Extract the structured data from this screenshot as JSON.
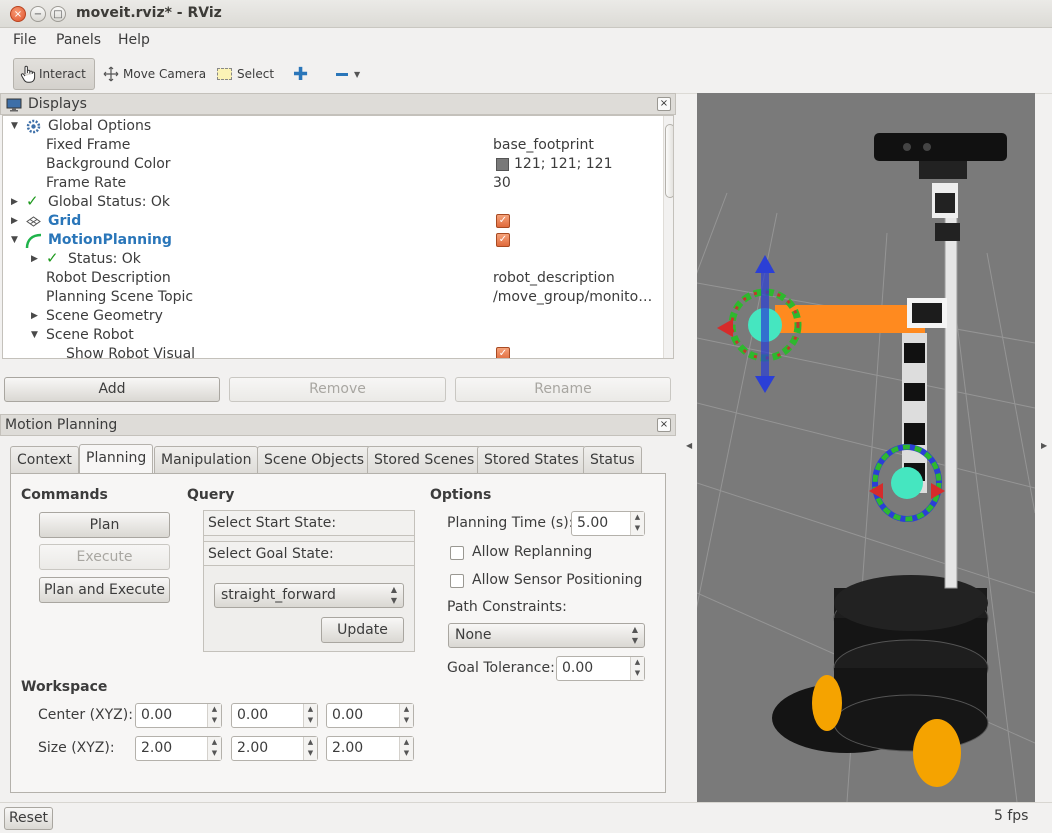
{
  "window": {
    "title": "moveit.rviz* - RViz",
    "close_glyph": "×",
    "min_glyph": "−",
    "max_glyph": "□"
  },
  "menu": {
    "file": "File",
    "panels": "Panels",
    "help": "Help"
  },
  "toolbar": {
    "interact": "Interact",
    "move_camera": "Move Camera",
    "select": "Select"
  },
  "displays": {
    "title": "Displays",
    "close": "×",
    "rows": [
      {
        "label": "Global Options",
        "value": ""
      },
      {
        "label": "Fixed Frame",
        "value": "base_footprint"
      },
      {
        "label": "Background Color",
        "value": "121; 121; 121"
      },
      {
        "label": "Frame Rate",
        "value": "30"
      },
      {
        "label": "Global Status: Ok",
        "value": ""
      },
      {
        "label": "Grid",
        "value": ""
      },
      {
        "label": "MotionPlanning",
        "value": ""
      },
      {
        "label": "Status: Ok",
        "value": ""
      },
      {
        "label": "Robot Description",
        "value": "robot_description"
      },
      {
        "label": "Planning Scene Topic",
        "value": "/move_group/monito…"
      },
      {
        "label": "Scene Geometry",
        "value": ""
      },
      {
        "label": "Scene Robot",
        "value": ""
      },
      {
        "label": "Show Robot Visual",
        "value": ""
      }
    ],
    "buttons": {
      "add": "Add",
      "remove": "Remove",
      "rename": "Rename"
    }
  },
  "motion_planning": {
    "title": "Motion Planning",
    "close": "×",
    "tabs": [
      "Context",
      "Planning",
      "Manipulation",
      "Scene Objects",
      "Stored Scenes",
      "Stored States",
      "Status"
    ],
    "active_tab": "Planning",
    "commands": {
      "title": "Commands",
      "plan": "Plan",
      "execute": "Execute",
      "plan_and_execute": "Plan and Execute"
    },
    "query": {
      "title": "Query",
      "start": "Select Start State:",
      "goal": "Select Goal State:",
      "goal_value": "straight_forward",
      "update": "Update"
    },
    "options": {
      "title": "Options",
      "planning_time_label": "Planning Time (s):",
      "planning_time": "5.00",
      "allow_replanning": "Allow Replanning",
      "allow_sensor": "Allow Sensor Positioning",
      "path_constraints_label": "Path Constraints:",
      "path_constraints": "None",
      "goal_tolerance_label": "Goal Tolerance:",
      "goal_tolerance": "0.00"
    },
    "workspace": {
      "title": "Workspace",
      "center_label": "Center (XYZ):",
      "center": [
        "0.00",
        "0.00",
        "0.00"
      ],
      "size_label": "Size (XYZ):",
      "size": [
        "2.00",
        "2.00",
        "2.00"
      ]
    }
  },
  "status": {
    "reset": "Reset",
    "fps": "5 fps"
  },
  "colors": {
    "accent": "#e06a3c",
    "link": "#2a76b9",
    "viewport_bg": "#797979"
  }
}
